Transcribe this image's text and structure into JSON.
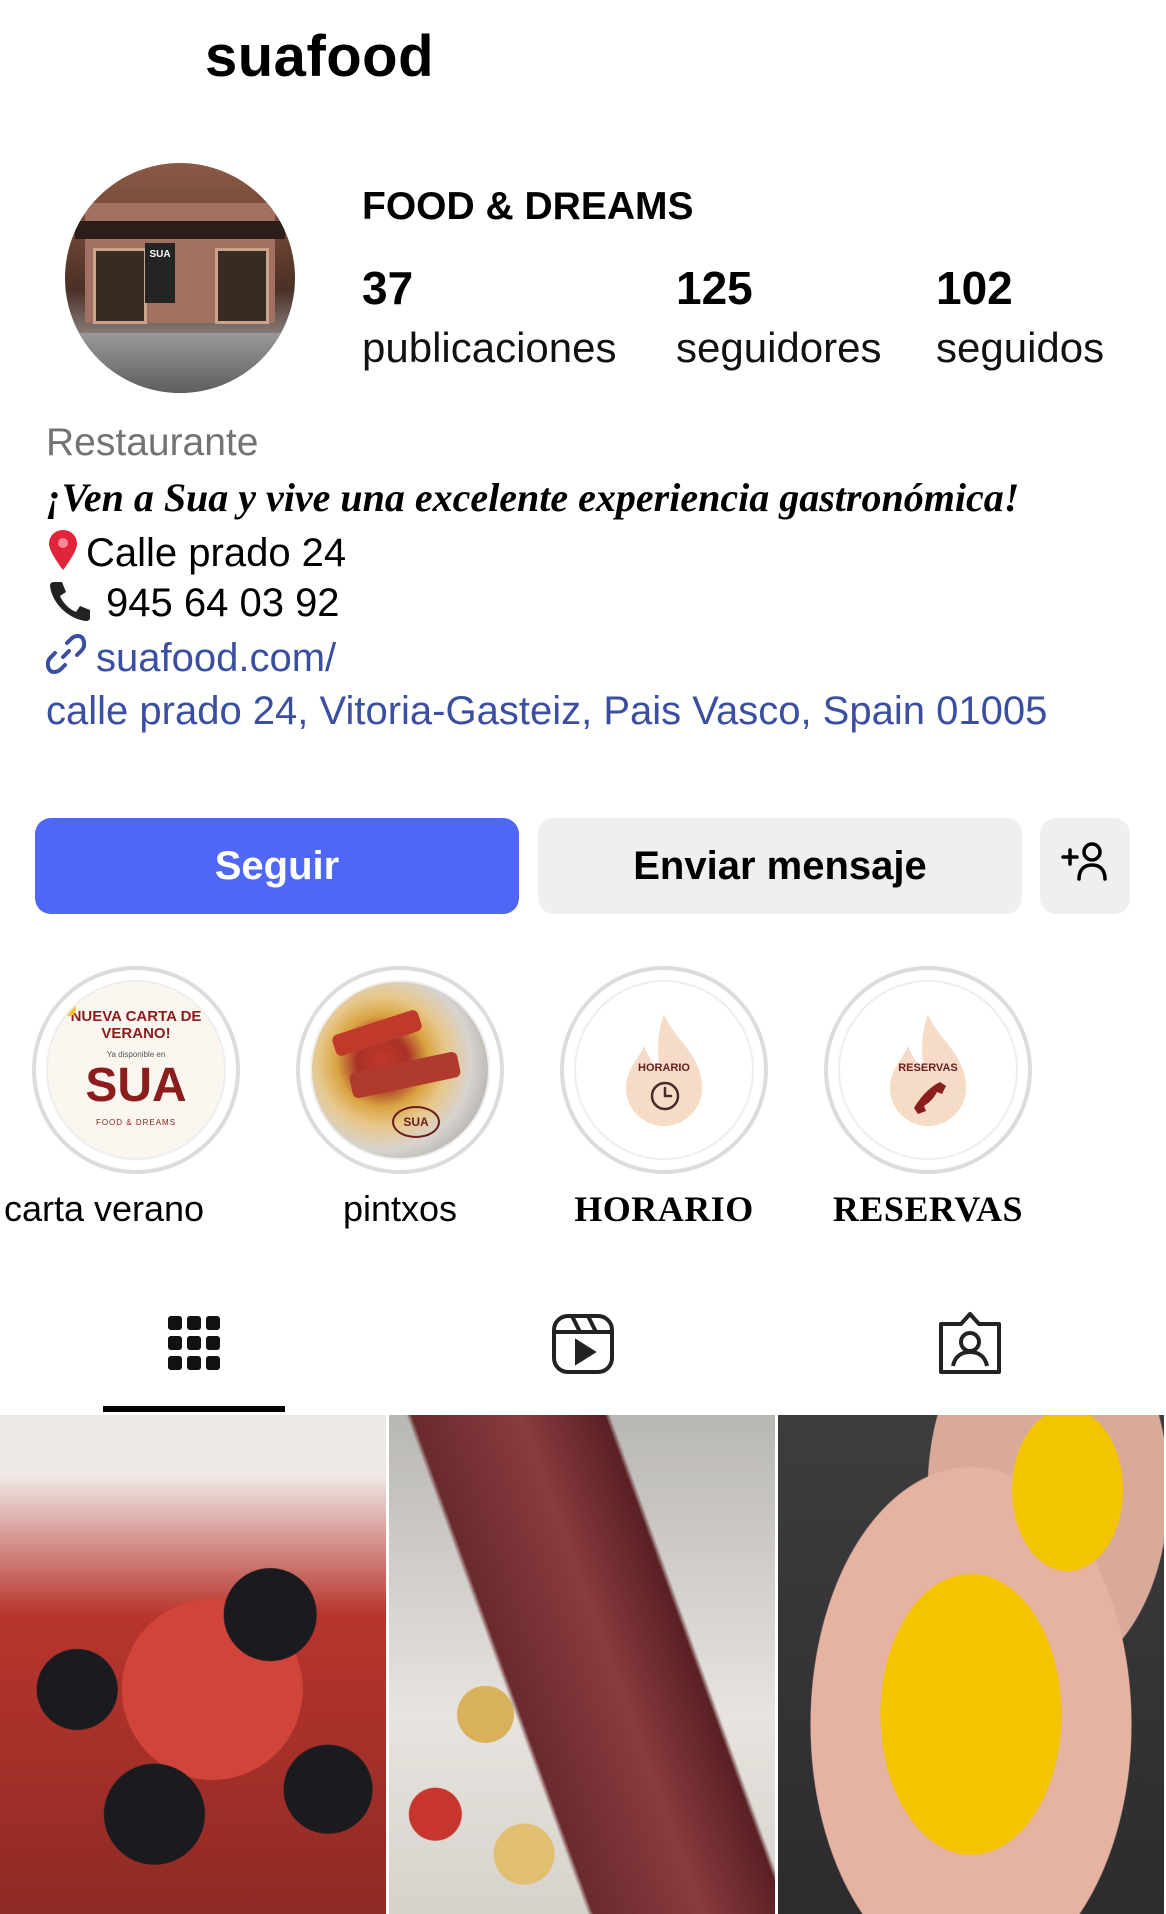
{
  "profile": {
    "username": "suafood",
    "display_name": "FOOD & DREAMS",
    "stats": [
      {
        "count": "37",
        "label": "publicaciones"
      },
      {
        "count": "125",
        "label": "seguidores"
      },
      {
        "count": "102",
        "label": "seguidos"
      }
    ],
    "category": "Restaurante",
    "tagline": "¡Ven a Sua y vive una excelente experiencia gastronómica!",
    "address_line": "Calle prado 24",
    "phone": "945 64 03 92",
    "website": "suafood.com/",
    "full_address": "calle prado 24, Vitoria-Gasteiz, Pais Vasco, Spain 01005",
    "avatar_sign": "SUA",
    "avatar_icon": "restaurant-storefront-photo"
  },
  "actions": {
    "follow": "Seguir",
    "message": "Enviar mensaje",
    "suggest_icon": "add-person-icon"
  },
  "highlights": [
    {
      "label": "carta verano",
      "cover_title": "NUEVA CARTA DE VERANO!",
      "cover_sub": "Ya disponible en",
      "cover_brand": "SUA",
      "cover_tag": "FOOD & DREAMS"
    },
    {
      "label": "pintxos",
      "cover_icon": "pintxos-photo",
      "cover_brand": "SUA"
    },
    {
      "label": "HORARIO",
      "cover_title": "HORARIO",
      "cover_icon": "clock-icon"
    },
    {
      "label": "RESERVAS",
      "cover_title": "RESERVAS",
      "cover_icon": "phone-icon"
    }
  ],
  "tabs": [
    {
      "name": "posts",
      "icon": "grid-icon",
      "active": true
    },
    {
      "name": "reels",
      "icon": "reels-icon",
      "active": false
    },
    {
      "name": "tagged",
      "icon": "tagged-icon",
      "active": false
    }
  ],
  "grid": [
    {
      "icon": "mussels-photo"
    },
    {
      "icon": "steak-photo"
    },
    {
      "icon": "scallops-photo"
    }
  ],
  "colors": {
    "accent": "#4f67f4",
    "link": "#3a4fa1",
    "secondary_text": "#737373",
    "button_gray": "#efeff2",
    "brand_red": "#8b1d1d"
  }
}
